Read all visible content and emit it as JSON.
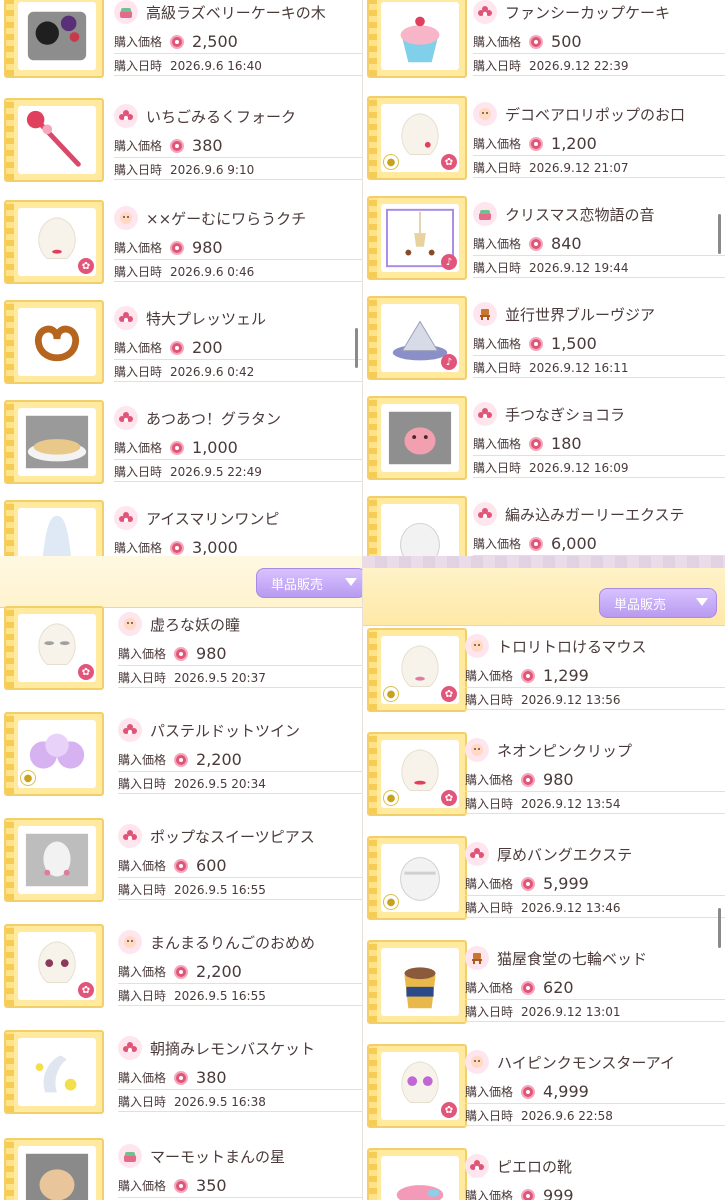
{
  "labels": {
    "price": "購入価格",
    "date": "購入日時",
    "sell_button": "単品販売"
  },
  "colors": {
    "accent": "#e05577",
    "frame": "#ffeaa0",
    "sell_button": "#b89af0"
  },
  "panels": {
    "top_left": {
      "items": [
        {
          "name": "高級ラズベリーケーキの木",
          "price": "2,500",
          "date": "2026.9.6 16:40",
          "icon": "cake-icon"
        },
        {
          "name": "いちごみるくフォーク",
          "price": "380",
          "date": "2026.9.6 9:10",
          "icon": "flower-icon"
        },
        {
          "name": "××ゲーむにワらうクチ",
          "price": "980",
          "date": "2026.9.6 0:46",
          "icon": "face-icon"
        },
        {
          "name": "特大プレッツェル",
          "price": "200",
          "date": "2026.9.6 0:42",
          "icon": "flower-icon"
        },
        {
          "name": "あつあつ！グラタン",
          "price": "1,000",
          "date": "2026.9.5 22:49",
          "icon": "flower-icon"
        },
        {
          "name": "アイスマリンワンピ",
          "price": "3,000",
          "date": "",
          "icon": "flower-icon"
        }
      ]
    },
    "top_right": {
      "items": [
        {
          "name": "ファンシーカップケーキ",
          "price": "500",
          "date": "2026.9.12 22:39",
          "icon": "flower-icon"
        },
        {
          "name": "デコベアロリポップのお口",
          "price": "1,200",
          "date": "2026.9.12 21:07",
          "icon": "face-icon"
        },
        {
          "name": "クリスマス恋物語の音",
          "price": "840",
          "date": "2026.9.12 19:44",
          "icon": "cake-icon"
        },
        {
          "name": "並行世界ブルーヴジア",
          "price": "1,500",
          "date": "2026.9.12 16:11",
          "icon": "chair-icon"
        },
        {
          "name": "手つなぎショコラ",
          "price": "180",
          "date": "2026.9.12 16:09",
          "icon": "flower-icon"
        },
        {
          "name": "編み込みガーリーエクステ",
          "price": "6,000",
          "date": "",
          "icon": "flower-icon"
        }
      ]
    },
    "bottom_left": {
      "items": [
        {
          "name": "虚ろな妖の瞳",
          "price": "980",
          "date": "2026.9.5 20:37",
          "icon": "face-icon"
        },
        {
          "name": "パステルドットツイン",
          "price": "2,200",
          "date": "2026.9.5 20:34",
          "icon": "flower-icon"
        },
        {
          "name": "ポップなスイーツピアス",
          "price": "600",
          "date": "2026.9.5 16:55",
          "icon": "flower-icon"
        },
        {
          "name": "まんまるりんごのおめめ",
          "price": "2,200",
          "date": "2026.9.5 16:55",
          "icon": "face-icon"
        },
        {
          "name": "朝摘みレモンバスケット",
          "price": "380",
          "date": "2026.9.5 16:38",
          "icon": "flower-icon"
        },
        {
          "name": "マーモットまんの星",
          "price": "350",
          "date": "",
          "icon": "cake-icon"
        }
      ]
    },
    "bottom_right": {
      "items": [
        {
          "name": "トロリトロけるマウス",
          "price": "1,299",
          "date": "2026.9.12 13:56",
          "icon": "face-icon"
        },
        {
          "name": "ネオンピンクリップ",
          "price": "980",
          "date": "2026.9.12 13:54",
          "icon": "face-icon"
        },
        {
          "name": "厚めバングエクステ",
          "price": "5,999",
          "date": "2026.9.12 13:46",
          "icon": "flower-icon"
        },
        {
          "name": "猫屋食堂の七輪ベッド",
          "price": "620",
          "date": "2026.9.12 13:01",
          "icon": "chair-icon"
        },
        {
          "name": "ハイピンクモンスターアイ",
          "price": "4,999",
          "date": "2026.9.6 22:58",
          "icon": "face-icon"
        },
        {
          "name": "ピエロの靴",
          "price": "999",
          "date": "",
          "icon": "flower-icon"
        }
      ]
    }
  }
}
